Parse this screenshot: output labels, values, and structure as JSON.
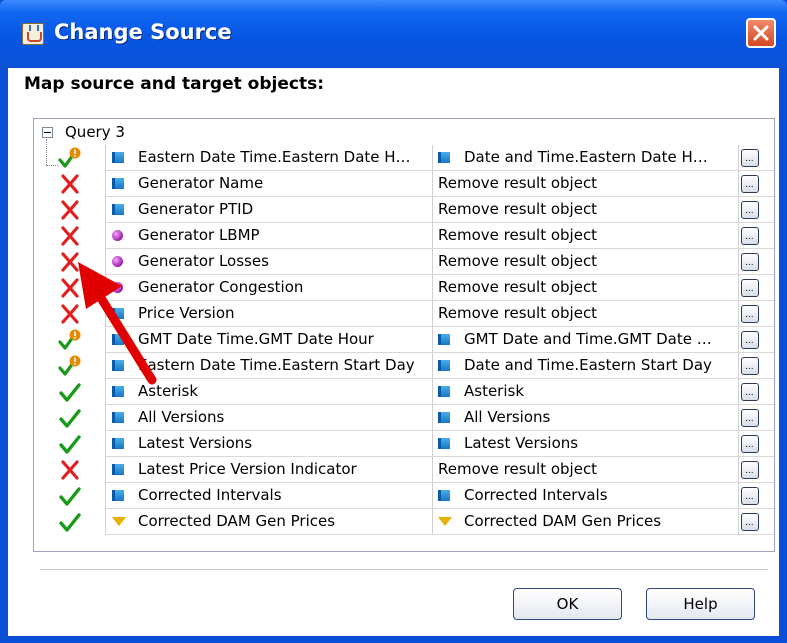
{
  "window": {
    "title": "Change Source"
  },
  "heading": "Map source and target objects:",
  "query": {
    "label": "Query 3"
  },
  "rows": [
    {
      "status": "warning",
      "src_icon": "dimension",
      "src": "Eastern Date Time.Eastern Date H…",
      "tgt_icon": "dimension",
      "tgt": "Date and Time.Eastern Date H…"
    },
    {
      "status": "remove",
      "src_icon": "dimension",
      "src": "Generator Name",
      "tgt_icon": "none",
      "tgt": "Remove result object"
    },
    {
      "status": "remove",
      "src_icon": "dimension",
      "src": "Generator PTID",
      "tgt_icon": "none",
      "tgt": "Remove result object"
    },
    {
      "status": "remove",
      "src_icon": "measure",
      "src": "Generator LBMP",
      "tgt_icon": "none",
      "tgt": "Remove result object"
    },
    {
      "status": "remove",
      "src_icon": "measure",
      "src": "Generator Losses",
      "tgt_icon": "none",
      "tgt": "Remove result object"
    },
    {
      "status": "remove",
      "src_icon": "measure",
      "src": "Generator Congestion",
      "tgt_icon": "none",
      "tgt": "Remove result object"
    },
    {
      "status": "remove",
      "src_icon": "dimension",
      "src": "Price Version",
      "tgt_icon": "none",
      "tgt": "Remove result object"
    },
    {
      "status": "warning",
      "src_icon": "dimension",
      "src": "GMT Date Time.GMT Date Hour",
      "tgt_icon": "dimension",
      "tgt": "GMT Date and Time.GMT Date …"
    },
    {
      "status": "warning",
      "src_icon": "dimension",
      "src": "Eastern Date Time.Eastern Start Day",
      "tgt_icon": "dimension",
      "tgt": "Date and Time.Eastern Start Day"
    },
    {
      "status": "ok",
      "src_icon": "dimension",
      "src": "Asterisk",
      "tgt_icon": "dimension",
      "tgt": "Asterisk"
    },
    {
      "status": "ok",
      "src_icon": "dimension",
      "src": "All Versions",
      "tgt_icon": "dimension",
      "tgt": "All Versions"
    },
    {
      "status": "ok",
      "src_icon": "dimension",
      "src": "Latest Versions",
      "tgt_icon": "dimension",
      "tgt": "Latest Versions"
    },
    {
      "status": "remove",
      "src_icon": "dimension",
      "src": "Latest Price Version Indicator",
      "tgt_icon": "none",
      "tgt": "Remove result object"
    },
    {
      "status": "ok",
      "src_icon": "dimension",
      "src": "Corrected Intervals",
      "tgt_icon": "dimension",
      "tgt": "Corrected Intervals"
    },
    {
      "status": "ok",
      "src_icon": "filter",
      "src": "Corrected DAM Gen Prices",
      "tgt_icon": "filter",
      "tgt": "Corrected DAM Gen Prices"
    }
  ],
  "ellipsis_label": "...",
  "buttons": {
    "ok": "OK",
    "help": "Help"
  },
  "colors": {
    "titlebar": "#0756e4",
    "remove": "#e02020",
    "ok": "#1a9a1a",
    "warning": "#e88a00",
    "arrow": "#e00000"
  }
}
